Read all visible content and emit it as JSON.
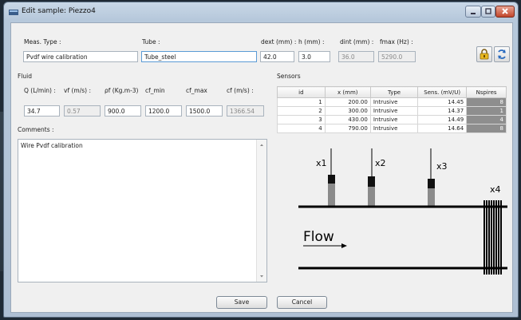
{
  "window": {
    "title": "Edit sample: Piezzo4"
  },
  "header_fields": {
    "meas_type": {
      "label": "Meas. Type :",
      "value": "Pvdf wire calibration"
    },
    "tube": {
      "label": "Tube :",
      "value": "Tube_steel"
    },
    "dext": {
      "label": "dext (mm) :",
      "value": "42.0"
    },
    "h": {
      "label": "h (mm) :",
      "value": "3.0"
    },
    "dint": {
      "label": "dint (mm) :",
      "value": "36.0"
    },
    "fmax": {
      "label": "fmax (Hz) :",
      "value": "5290.0"
    }
  },
  "fluid": {
    "title": "Fluid",
    "q": {
      "label": "Q (L/min) :",
      "value": "34.7"
    },
    "vf": {
      "label": "vf (m/s) :",
      "value": "0.57"
    },
    "rho": {
      "label": "ρf (Kg.m-3)",
      "value": "900.0"
    },
    "cf_min": {
      "label": "cf_min",
      "value": "1200.0"
    },
    "cf_max": {
      "label": "cf_max",
      "value": "1500.0"
    },
    "cf": {
      "label": "cf (m/s) :",
      "value": "1366.54"
    }
  },
  "comments": {
    "label": "Comments :",
    "text": "Wire Pvdf calibration"
  },
  "sensors": {
    "title": "Sensors",
    "columns": [
      "id",
      "x (mm)",
      "Type",
      "Sens. (mV/U)",
      "Nspires"
    ],
    "rows": [
      {
        "id": "1",
        "x": "200.00",
        "type": "Intrusive",
        "sens": "14.45",
        "nspires": "8"
      },
      {
        "id": "2",
        "x": "300.00",
        "type": "Intrusive",
        "sens": "14.37",
        "nspires": "1"
      },
      {
        "id": "3",
        "x": "430.00",
        "type": "Intrusive",
        "sens": "14.49",
        "nspires": "4"
      },
      {
        "id": "4",
        "x": "790.00",
        "type": "Intrusive",
        "sens": "14.64",
        "nspires": "8"
      }
    ]
  },
  "diagram": {
    "labels": [
      "x1",
      "x2",
      "x3",
      "x4"
    ],
    "flow_label": "Flow"
  },
  "buttons": {
    "save": "Save",
    "cancel": "Cancel"
  },
  "icons": {
    "lock": "lock-icon",
    "refresh": "refresh-icon"
  }
}
